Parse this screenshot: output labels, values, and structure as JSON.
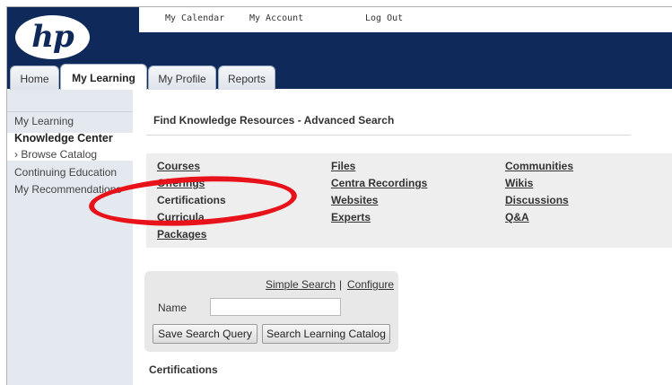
{
  "header": {
    "logo_text": "hp",
    "top_links": [
      "My Calendar",
      "My Account",
      "Log Out"
    ]
  },
  "tabs": [
    {
      "label": "Home",
      "active": false
    },
    {
      "label": "My Learning",
      "active": true
    },
    {
      "label": "My Profile",
      "active": false
    },
    {
      "label": "Reports",
      "active": false
    }
  ],
  "sidebar": {
    "items": [
      {
        "label": "My Learning"
      },
      {
        "label": "Knowledge Center"
      },
      {
        "label": "› Browse Catalog"
      },
      {
        "label": "Continuing Education"
      },
      {
        "label": "My Recommendations"
      }
    ]
  },
  "main": {
    "title": "Find Knowledge Resources - Advanced Search",
    "resource_columns": [
      [
        "Courses",
        "Offerings",
        "Certifications",
        "Curricula",
        "Packages"
      ],
      [
        "Files",
        "Centra Recordings",
        "Websites",
        "Experts"
      ],
      [
        "Communities",
        "Wikis",
        "Discussions",
        "Q&A"
      ]
    ],
    "search": {
      "simple_search": "Simple Search",
      "separator": "|",
      "configure": "Configure",
      "name_label": "Name",
      "name_value": "",
      "save_button": "Save Search Query",
      "search_button": "Search Learning Catalog"
    },
    "section_label": "Certifications"
  },
  "colors": {
    "header_navy": "#0f2a5a",
    "sidebar_bg": "#e3e9ef",
    "annotation_red": "#e8121b"
  }
}
